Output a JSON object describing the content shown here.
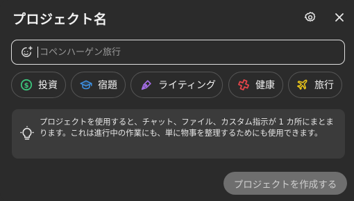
{
  "dialog": {
    "title": "プロジェクト名"
  },
  "name_field": {
    "placeholder": "コペンハーゲン旅行",
    "value": ""
  },
  "categories": [
    {
      "label": "投資",
      "icon": "dollar-coin-icon",
      "color": "#3cc47b"
    },
    {
      "label": "宿題",
      "icon": "graduation-cap-icon",
      "color": "#3d8fe0"
    },
    {
      "label": "ライティング",
      "icon": "pen-nib-icon",
      "color": "#a56ee8"
    },
    {
      "label": "健康",
      "icon": "medical-cross-icon",
      "color": "#e8454a"
    },
    {
      "label": "旅行",
      "icon": "airplane-icon",
      "color": "#e9c419"
    }
  ],
  "info": {
    "icon": "lightbulb-icon",
    "text": "プロジェクトを使用すると、チャット、ファイル、カスタム指示が 1 カ所にまとまります。これは進行中の作業にも、単に物事を整理するためにも使用できます。"
  },
  "actions": {
    "create_label": "プロジェクトを作成する"
  },
  "colors": {
    "background": "#2b2b2b",
    "info_background": "#3b3b3b",
    "create_button": "#6e6e6e"
  }
}
